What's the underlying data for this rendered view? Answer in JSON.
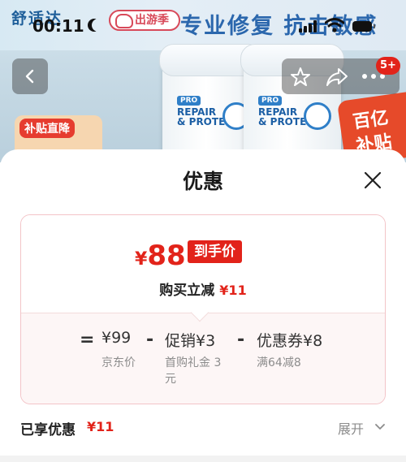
{
  "status_bar": {
    "time": "00:11"
  },
  "background": {
    "brand": "舒适达",
    "trip_badge": "出游季",
    "slogan": "专业修复 抗击敏感",
    "product_pro": "PRO",
    "product_name_line1": "REPAIR",
    "product_name_line2": "& PROTECT",
    "notification_count": "5+",
    "subsidy_left": "补贴直降",
    "subsidy_right_line1": "百亿",
    "subsidy_right_line2": "补贴"
  },
  "sheet": {
    "title": "优惠",
    "final_price": {
      "currency": "¥",
      "amount": "88",
      "tag": "到手价"
    },
    "instant_discount": {
      "label": "购买立减",
      "amount": "¥11"
    },
    "breakdown": [
      {
        "operator": "=",
        "value": "¥99",
        "desc": "京东价"
      },
      {
        "operator": "-",
        "value": "促销¥3",
        "desc": "首购礼金 3元"
      },
      {
        "operator": "-",
        "value": "优惠券¥8",
        "desc": "满64减8"
      }
    ],
    "enjoyed": {
      "label": "已享优惠",
      "amount": "¥11"
    },
    "expand_label": "展开"
  },
  "colors": {
    "accent": "#e2231a",
    "card_border": "#f3c4c8",
    "muted_text": "#8c8c8c"
  }
}
